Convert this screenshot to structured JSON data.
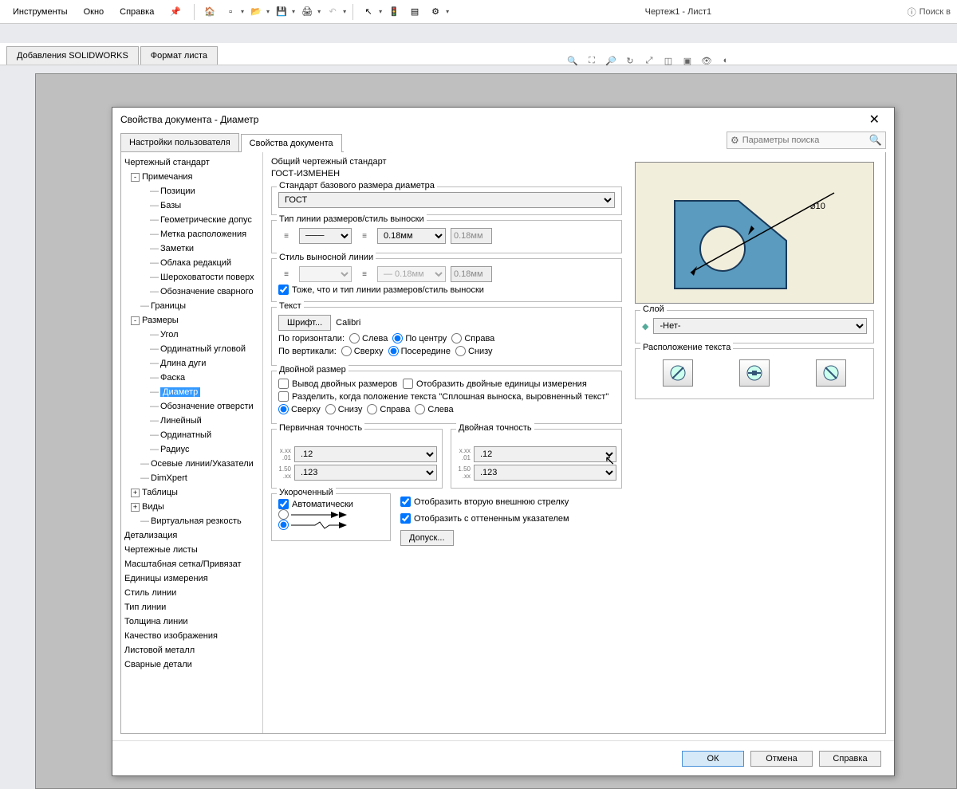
{
  "menubar": {
    "items": [
      "Инструменты",
      "Окно",
      "Справка"
    ],
    "title": "Чертеж1 - Лист1",
    "search": "Поиск в"
  },
  "ribbon": {
    "tabs": [
      "Добавления SOLIDWORKS",
      "Формат листа"
    ]
  },
  "dialog": {
    "title": "Свойства документа - Диаметр",
    "tabs": [
      "Настройки пользователя",
      "Свойства документа"
    ],
    "search_placeholder": "Параметры поиска",
    "tree": {
      "root": "Чертежный стандарт",
      "annotations": "Примечания",
      "ann_children": [
        "Позиции",
        "Базы",
        "Геометрические допус",
        "Метка расположения",
        "Заметки",
        "Облака редакций",
        "Шероховатости поверх",
        "Обозначение сварного"
      ],
      "borders": "Границы",
      "dimensions": "Размеры",
      "dim_children": [
        "Угол",
        "Ординатный угловой",
        "Длина дуги",
        "Фаска",
        "Диаметр",
        "Обозначение отверсти",
        "Линейный",
        "Ординатный",
        "Радиус"
      ],
      "rest": [
        "Осевые линии/Указатели",
        "DimXpert",
        "Таблицы",
        "Виды",
        "Виртуальная резкость",
        "Детализация",
        "Чертежные листы",
        "Масштабная сетка/Привязат",
        "Единицы измерения",
        "Стиль линии",
        "Тип линии",
        "Толщина линии",
        "Качество изображения",
        "Листовой металл",
        "Сварные детали"
      ]
    },
    "std_label": "Общий чертежный стандарт",
    "std_value": "ГОСТ-ИЗМЕНЕН",
    "base_std": {
      "legend": "Стандарт базового размера диаметра",
      "value": "ГОСТ"
    },
    "leader_style": {
      "legend": "Тип линии размеров/стиль выноски",
      "thick": "0.18мм",
      "disp": "0.18мм"
    },
    "ext_style": {
      "legend": "Стиль выносной линии",
      "thick": "0.18мм",
      "disp": "0.18мм",
      "same": "Тоже, что и тип линии размеров/стиль выноски"
    },
    "text": {
      "legend": "Текст",
      "font_btn": "Шрифт...",
      "font": "Calibri",
      "h_label": "По горизонтали:",
      "h_opts": [
        "Слева",
        "По центру",
        "Справа"
      ],
      "v_label": "По вертикали:",
      "v_opts": [
        "Сверху",
        "Посередине",
        "Снизу"
      ]
    },
    "dual": {
      "legend": "Двойной размер",
      "show": "Вывод двойных размеров",
      "units": "Отобразить двойные единицы измерения",
      "split": "Разделить, когда положение текста \"Сплошная выноска, выровненный текст\"",
      "pos": [
        "Сверху",
        "Снизу",
        "Справа",
        "Слева"
      ]
    },
    "prec1": {
      "legend": "Первичная точность",
      "v1": ".12",
      "v2": ".123"
    },
    "prec2": {
      "legend": "Двойная точность",
      "v1": ".12",
      "v2": ".123"
    },
    "short": {
      "legend": "Укороченный",
      "auto": "Автоматически"
    },
    "arrow2": "Отобразить вторую внешнюю стрелку",
    "shaded": "Отобразить с оттененным указателем",
    "tol_btn": "Допуск...",
    "layer": {
      "legend": "Слой",
      "value": "-Нет-"
    },
    "text_pos": {
      "legend": "Расположение текста"
    },
    "dim_label": "⌀10",
    "buttons": {
      "ok": "ОК",
      "cancel": "Отмена",
      "help": "Справка"
    }
  }
}
